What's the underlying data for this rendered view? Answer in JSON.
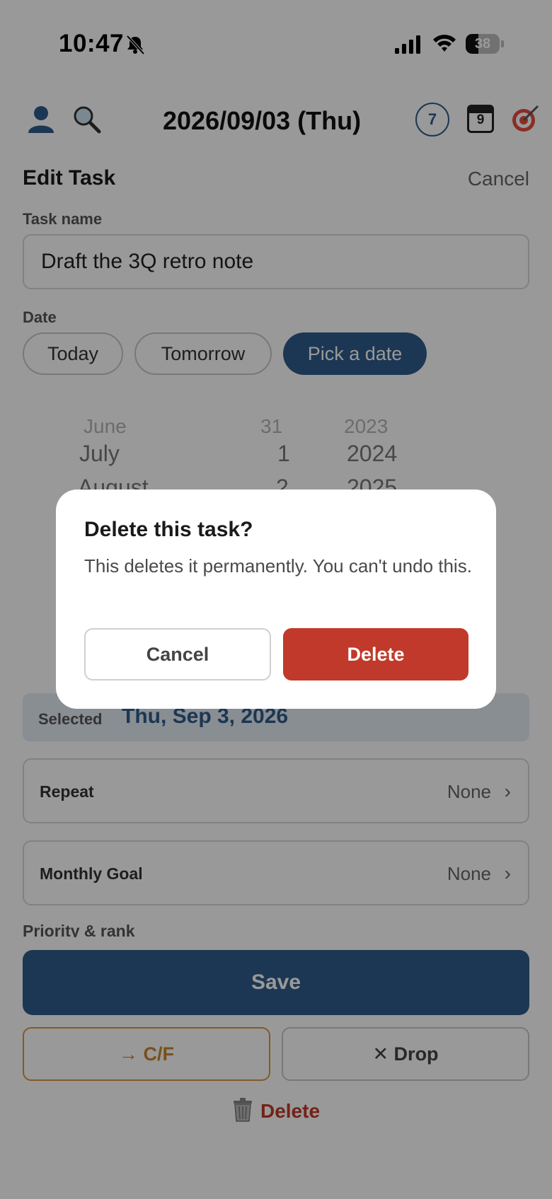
{
  "status_bar": {
    "time": "10:47",
    "battery": "38",
    "battery_level": 0.38
  },
  "header": {
    "date": "2026/09/03 (Thu)",
    "week_badge": "7",
    "calendar_day": "9"
  },
  "sheet": {
    "title": "Edit Task",
    "cancel": "Cancel",
    "task_name_label": "Task name",
    "task_name_value": "Draft the 3Q retro note",
    "date_label": "Date",
    "date_options": [
      "Today",
      "Tomorrow",
      "Pick a date"
    ],
    "active_date_option": "Pick a date",
    "picker": {
      "months": [
        "June",
        "July",
        "August"
      ],
      "days": [
        "31",
        "1",
        "2"
      ],
      "years": [
        "2023",
        "2024",
        "2025"
      ]
    },
    "selected_label": "Selected",
    "selected_value": "Thu, Sep 3, 2026",
    "repeat_label": "Repeat",
    "repeat_value": "None",
    "monthly_goal_label": "Monthly Goal",
    "monthly_goal_value": "None",
    "priority_label": "Priority & rank",
    "save": "Save",
    "carry_forward": "→ C/F",
    "drop": "✕ Drop",
    "delete": "Delete"
  },
  "dialog": {
    "title": "Delete this task?",
    "message": "This deletes it permanently. You can't undo this.",
    "cancel": "Cancel",
    "delete": "Delete"
  },
  "colors": {
    "accent": "#2f5c8a",
    "danger": "#c0392b",
    "carry_forward": "#c9862a"
  }
}
